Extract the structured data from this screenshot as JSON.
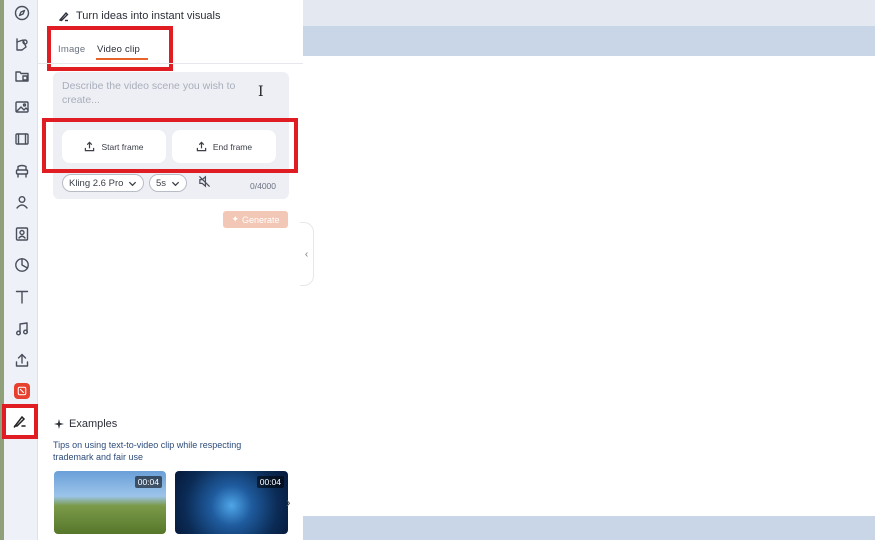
{
  "rail": {
    "icons": [
      "compass-icon",
      "shapes-icon",
      "folder-icon",
      "image-icon",
      "film-icon",
      "chair-icon",
      "person-icon",
      "user-badge-icon",
      "chart-icon",
      "text-icon",
      "music-icon",
      "upload-icon",
      "app-icon",
      "magic-pen-icon"
    ]
  },
  "panel": {
    "header": "Turn ideas into instant visuals",
    "tabs": [
      {
        "label": "Image"
      },
      {
        "label": "Video clip"
      }
    ],
    "prompt_placeholder": "Describe the video scene you wish to create...",
    "start_frame_label": "Start frame",
    "end_frame_label": "End frame",
    "model_label": "Kling 2.6 Pro",
    "duration_label": "5s",
    "char_counter": "0/4000",
    "generate_label": "Generate"
  },
  "examples": {
    "title": "Examples",
    "tip": "Tips on using text-to-video clip while respecting trademark and fair use",
    "thumbs": [
      {
        "duration": "00:04"
      },
      {
        "duration": "00:04"
      }
    ]
  },
  "colors": {
    "highlight": "#e11d24",
    "accent": "#e8642f",
    "generate_disabled": "#f3c7b5"
  }
}
